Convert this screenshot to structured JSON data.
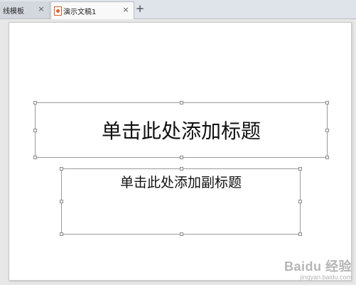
{
  "tabs": [
    {
      "label": "线模板",
      "close": "×"
    },
    {
      "label": "演示文稿1",
      "close": "×"
    }
  ],
  "new_tab_symbol": "+",
  "slide": {
    "title_placeholder": "单击此处添加标题",
    "subtitle_placeholder": "单击此处添加副标题"
  },
  "watermark": {
    "text": "Baidu 经验",
    "url": "jingyan.baidu.com"
  }
}
